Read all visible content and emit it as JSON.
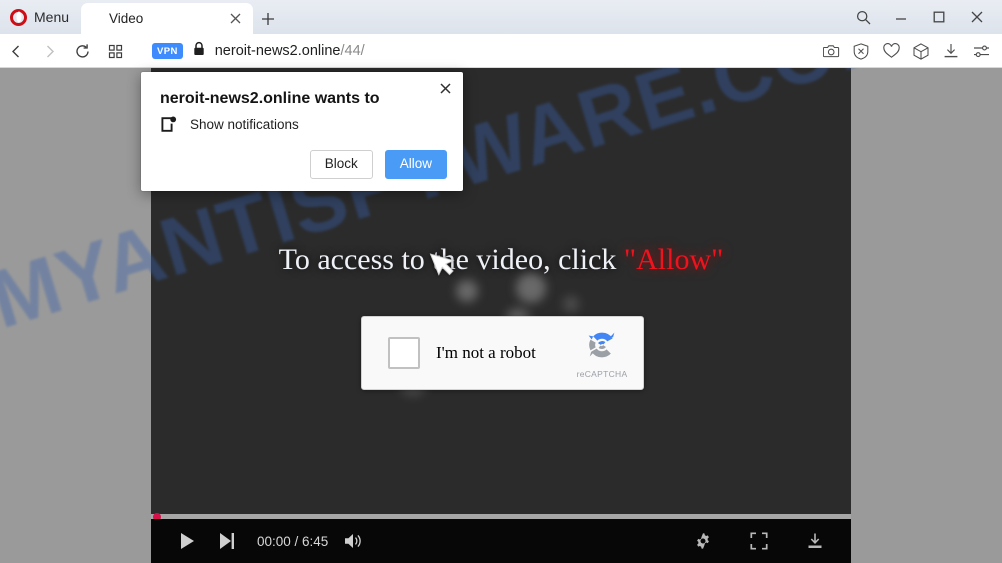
{
  "browser": {
    "menu_label": "Menu",
    "logo_icon": "opera-logo-icon",
    "tab": {
      "title": "Video",
      "close_icon": "close-icon"
    },
    "new_tab_icon": "plus-icon",
    "window_controls": {
      "search_icon": "search-icon",
      "minimize_icon": "minimize-icon",
      "maximize_icon": "maximize-icon",
      "close_icon": "close-icon"
    },
    "toolbar": {
      "back_icon": "back-arrow-icon",
      "forward_icon": "forward-arrow-icon",
      "reload_icon": "reload-icon",
      "tiles_icon": "grid-tiles-icon",
      "vpn_badge": "VPN",
      "lock_icon": "padlock-icon",
      "url_domain": "neroit-news2.online",
      "url_path": "/44/",
      "right_icons": [
        "snapshot-camera-icon",
        "ad-blocker-shield-icon",
        "heart-icon",
        "crypto-wallet-cube-icon",
        "downloads-icon",
        "easy-setup-sliders-icon"
      ]
    }
  },
  "permission_dialog": {
    "title": "neroit-news2.online wants to",
    "permission_icon": "notifications-icon",
    "permission_label": "Show notifications",
    "block_label": "Block",
    "allow_label": "Allow",
    "close_icon": "close-icon",
    "allow_color": "#4a9bf5"
  },
  "page": {
    "watermark": "MYANTISPYWARE.COM",
    "headline_prefix": "To access to the video, click ",
    "headline_highlight": "\"Allow\"",
    "highlight_color": "#f0121d",
    "cursor_icon": "mouse-cursor-icon"
  },
  "recaptcha": {
    "checkbox_name": "im-not-a-robot-checkbox",
    "label": "I'm not a robot",
    "brand_text": "reCAPTCHA",
    "logo_icon": "recaptcha-logo-icon"
  },
  "player": {
    "play_icon": "play-icon",
    "next_icon": "next-track-icon",
    "time": "00:00 / 6:45",
    "volume_icon": "volume-icon",
    "settings_icon": "gear-icon",
    "fullscreen_icon": "fullscreen-icon",
    "download_icon": "download-icon",
    "progress_percent": 0
  }
}
